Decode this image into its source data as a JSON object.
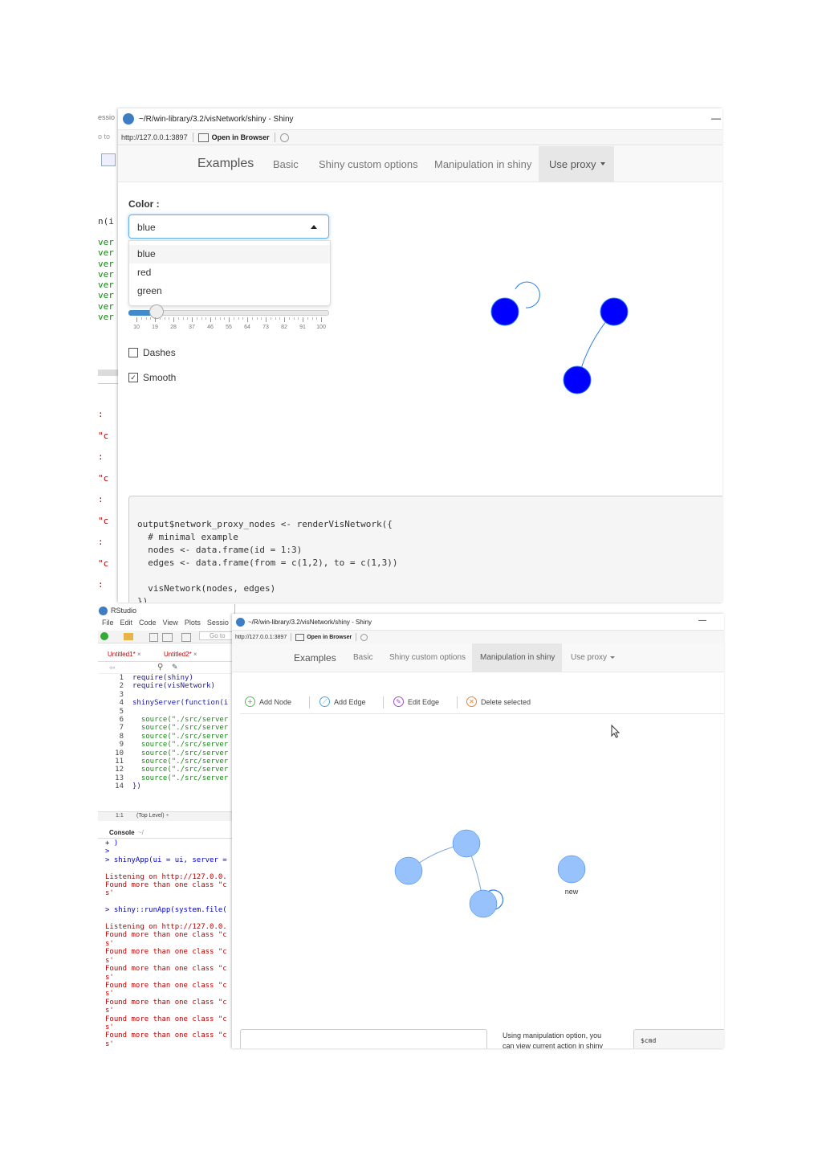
{
  "bg_rstudio_top": {
    "menu_fragment": "essio",
    "goto_fragment": "o to",
    "func_fragment": "n(i",
    "ver_lines": [
      "ver",
      "ver",
      "ver",
      "ver",
      "ver",
      "ver",
      "ver",
      "ver"
    ],
    "console_lines": [
      ": \"c",
      ": \"c",
      ": \"c",
      ": \"c",
      ": \"c",
      ": \"c",
      ": \"c",
      ": \"c",
      ": \"c"
    ]
  },
  "window_top": {
    "title": "~/R/win-library/3.2/visNetwork/shiny - Shiny",
    "url": "http://127.0.0.1:3897",
    "open_in_browser": "Open in Browser",
    "nav": {
      "brand": "Examples",
      "tabs": [
        "Basic",
        "Shiny custom options",
        "Manipulation in shiny",
        "Use proxy"
      ],
      "active_tab": "Use proxy"
    },
    "color_label": "Color :",
    "color_value": "blue",
    "dropdown_options": [
      "blue",
      "red",
      "green"
    ],
    "slider_ticks": [
      "10",
      "19",
      "28",
      "37",
      "46",
      "55",
      "64",
      "73",
      "82",
      "91",
      "100"
    ],
    "slider_value": 19,
    "dashes_label": "Dashes",
    "dashes_checked": false,
    "smooth_label": "Smooth",
    "smooth_checked": true,
    "node_color": "#0000ff",
    "code_lines": [
      "output$network_proxy_nodes <- renderVisNetwork({",
      "  # minimal example",
      "  nodes <- data.frame(id = 1:3)",
      "  edges <- data.frame(from = c(1,2), to = c(1,3))",
      "",
      "  visNetwork(nodes, edges)",
      "})"
    ]
  },
  "rstudio_bottom": {
    "app_title": "RStudio",
    "menu": [
      "File",
      "Edit",
      "Code",
      "View",
      "Plots",
      "Sessio"
    ],
    "goto_label": "Go to",
    "tabs": [
      "Untitled1*",
      "Untitled2*"
    ],
    "editor_lines": [
      {
        "num": "1",
        "text": "require(shiny)"
      },
      {
        "num": "2",
        "text": "require(visNetwork)"
      },
      {
        "num": "3",
        "text": ""
      },
      {
        "num": "4",
        "text": "shinyServer(function(i"
      },
      {
        "num": "5",
        "text": ""
      },
      {
        "num": "6",
        "text": "  source(\"./src/server"
      },
      {
        "num": "7",
        "text": "  source(\"./src/server"
      },
      {
        "num": "8",
        "text": "  source(\"./src/server"
      },
      {
        "num": "9",
        "text": "  source(\"./src/server"
      },
      {
        "num": "10",
        "text": "  source(\"./src/server"
      },
      {
        "num": "11",
        "text": "  source(\"./src/server"
      },
      {
        "num": "12",
        "text": "  source(\"./src/server"
      },
      {
        "num": "13",
        "text": "  source(\"./src/server"
      },
      {
        "num": "14",
        "text": "})"
      }
    ],
    "status_pos": "1:1",
    "status_level": "(Top Level) ÷",
    "console_label": "Console",
    "console_path": "~/",
    "console_lines": [
      {
        "text": "+ )",
        "color": "#0000cc"
      },
      {
        "text": ">",
        "color": "#0000cc"
      },
      {
        "text": "> shinyApp(ui = ui, server =",
        "color": "#0000cc"
      },
      {
        "text": "",
        "color": "#000"
      },
      {
        "text": "Listening on http://127.0.0.",
        "color": "#c00000"
      },
      {
        "text": "Found more than one class \"c",
        "color": "#c00000"
      },
      {
        "text": "s'",
        "color": "#c00000"
      },
      {
        "text": "",
        "color": "#000"
      },
      {
        "text": "> shiny::runApp(system.file(",
        "color": "#0000cc"
      },
      {
        "text": "",
        "color": "#000"
      },
      {
        "text": "Listening on http://127.0.0.",
        "color": "#c00000"
      },
      {
        "text": "Found more than one class \"c",
        "color": "#c00000"
      },
      {
        "text": "s'",
        "color": "#c00000"
      },
      {
        "text": "Found more than one class \"c",
        "color": "#c00000"
      },
      {
        "text": "s'",
        "color": "#c00000"
      },
      {
        "text": "Found more than one class \"c",
        "color": "#c00000"
      },
      {
        "text": "s'",
        "color": "#c00000"
      },
      {
        "text": "Found more than one class \"c",
        "color": "#c00000"
      },
      {
        "text": "s'",
        "color": "#c00000"
      },
      {
        "text": "Found more than one class \"c",
        "color": "#c00000"
      },
      {
        "text": "s'",
        "color": "#c00000"
      },
      {
        "text": "Found more than one class \"c",
        "color": "#c00000"
      },
      {
        "text": "s'",
        "color": "#c00000"
      },
      {
        "text": "Found more than one class \"c",
        "color": "#c00000"
      },
      {
        "text": "s'",
        "color": "#c00000"
      }
    ]
  },
  "window_bottom": {
    "title": "~/R/win-library/3.2/visNetwork/shiny - Shiny",
    "url": "http://127.0.0.1:3897",
    "open_in_browser": "Open in Browser",
    "nav": {
      "brand": "Examples",
      "tabs": [
        "Basic",
        "Shiny custom options",
        "Manipulation in shiny",
        "Use proxy"
      ],
      "active_tab": "Manipulation in shiny"
    },
    "toolbar": {
      "add_node": "Add Node",
      "add_edge": "Add Edge",
      "edit_edge": "Edit Edge",
      "delete_selected": "Delete selected"
    },
    "node_color": "#97c2fc",
    "new_node_label": "new",
    "info_text_1": "Using manipulation option, you",
    "info_text_2": "can view current action in shiny",
    "cmd_label": "$cmd"
  }
}
